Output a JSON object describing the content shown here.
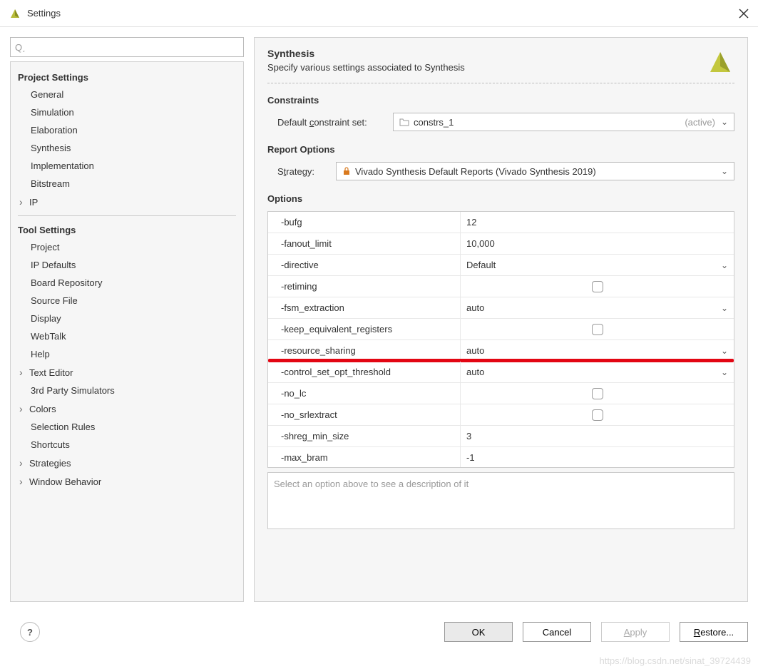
{
  "window": {
    "title": "Settings"
  },
  "sidebar": {
    "search_placeholder": "",
    "project_header": "Project Settings",
    "project_items": [
      {
        "label": "General",
        "expandable": false
      },
      {
        "label": "Simulation",
        "expandable": false
      },
      {
        "label": "Elaboration",
        "expandable": false
      },
      {
        "label": "Synthesis",
        "expandable": false
      },
      {
        "label": "Implementation",
        "expandable": false
      },
      {
        "label": "Bitstream",
        "expandable": false
      },
      {
        "label": "IP",
        "expandable": true
      }
    ],
    "tool_header": "Tool Settings",
    "tool_items": [
      {
        "label": "Project",
        "expandable": false
      },
      {
        "label": "IP Defaults",
        "expandable": false
      },
      {
        "label": "Board Repository",
        "expandable": false
      },
      {
        "label": "Source File",
        "expandable": false
      },
      {
        "label": "Display",
        "expandable": false
      },
      {
        "label": "WebTalk",
        "expandable": false
      },
      {
        "label": "Help",
        "expandable": false
      },
      {
        "label": "Text Editor",
        "expandable": true
      },
      {
        "label": "3rd Party Simulators",
        "expandable": false
      },
      {
        "label": "Colors",
        "expandable": true
      },
      {
        "label": "Selection Rules",
        "expandable": false
      },
      {
        "label": "Shortcuts",
        "expandable": false
      },
      {
        "label": "Strategies",
        "expandable": true
      },
      {
        "label": "Window Behavior",
        "expandable": true
      }
    ]
  },
  "main": {
    "title": "Synthesis",
    "subtitle": "Specify various settings associated to Synthesis",
    "constraints": {
      "header": "Constraints",
      "label": "Default constraint set:",
      "value": "constrs_1",
      "status": "(active)"
    },
    "report": {
      "header": "Report Options",
      "label": "Strategy:",
      "value": "Vivado Synthesis Default Reports (Vivado Synthesis 2019)"
    },
    "options": {
      "header": "Options",
      "rows": [
        {
          "name": "-bufg",
          "value": "12",
          "type": "text"
        },
        {
          "name": "-fanout_limit",
          "value": "10,000",
          "type": "text"
        },
        {
          "name": "-directive",
          "value": "Default",
          "type": "dropdown"
        },
        {
          "name": "-retiming",
          "value": "",
          "type": "checkbox"
        },
        {
          "name": "-fsm_extraction",
          "value": "auto",
          "type": "dropdown"
        },
        {
          "name": "-keep_equivalent_registers",
          "value": "",
          "type": "checkbox"
        },
        {
          "name": "-resource_sharing",
          "value": "auto",
          "type": "dropdown",
          "highlighted": true
        },
        {
          "name": "-control_set_opt_threshold",
          "value": "auto",
          "type": "dropdown"
        },
        {
          "name": "-no_lc",
          "value": "",
          "type": "checkbox"
        },
        {
          "name": "-no_srlextract",
          "value": "",
          "type": "checkbox"
        },
        {
          "name": "-shreg_min_size",
          "value": "3",
          "type": "text"
        },
        {
          "name": "-max_bram",
          "value": "-1",
          "type": "text"
        }
      ],
      "description_placeholder": "Select an option above to see a description of it"
    }
  },
  "buttons": {
    "help": "?",
    "ok": "OK",
    "cancel": "Cancel",
    "apply": "Apply",
    "restore": "Restore..."
  },
  "watermark": "https://blog.csdn.net/sinat_39724439"
}
